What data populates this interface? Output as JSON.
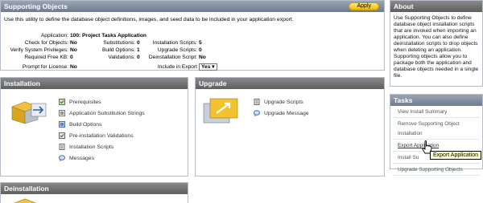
{
  "supporting": {
    "title": "Supporting Objects",
    "apply_label": "Apply",
    "description": "Use this utility to define the database object definitions, images, and seed data to be included in your application export.",
    "application_label": "Application:",
    "application_value": "100: Project Tasks Application",
    "check_label": "Check for Objects:",
    "check_value": "No",
    "verify_label": "Verify System Privileges:",
    "verify_value": "No",
    "free_kb_label": "Required Free KB:",
    "free_kb_value": "0",
    "prompt_label": "Prompt for License:",
    "prompt_value": "No",
    "subs_label": "Substitutions:",
    "subs_value": "0",
    "build_label": "Build Options:",
    "build_value": "1",
    "valid_label": "Validations:",
    "valid_value": "0",
    "inst_scripts_label": "Installation Scripts:",
    "inst_scripts_value": "5",
    "upg_scripts_label": "Upgrade Scripts:",
    "upg_scripts_value": "0",
    "deinst_script_label": "Deinstallation Script:",
    "deinst_script_value": "No",
    "include_label": "Include in Export",
    "include_value": "Yes"
  },
  "installation": {
    "title": "Installation",
    "items": [
      "Prerequisites",
      "Application Substitution Strings",
      "Build Options",
      "Pre-installation Validations",
      "Installation Scripts",
      "Messages"
    ]
  },
  "upgrade": {
    "title": "Upgrade",
    "items": [
      "Upgrade Scripts",
      "Upgrade Message"
    ]
  },
  "deinstallation": {
    "title": "Deinstallation"
  },
  "about": {
    "title": "About",
    "text": "Use Supporting Objects to define database object installation scripts that are invoked when importing an application. You can also define deinstallation scripts to drop objects when deleting an application. Supporting objects allow you to package both the application and database objects needed in a single file."
  },
  "tasks": {
    "title": "Tasks",
    "items": [
      "View Install Summary",
      "Remove Supporting Object Installation",
      "Export Application",
      "Install Su",
      "Upgrade Supporting Objects"
    ]
  },
  "tooltip": "Export Application"
}
